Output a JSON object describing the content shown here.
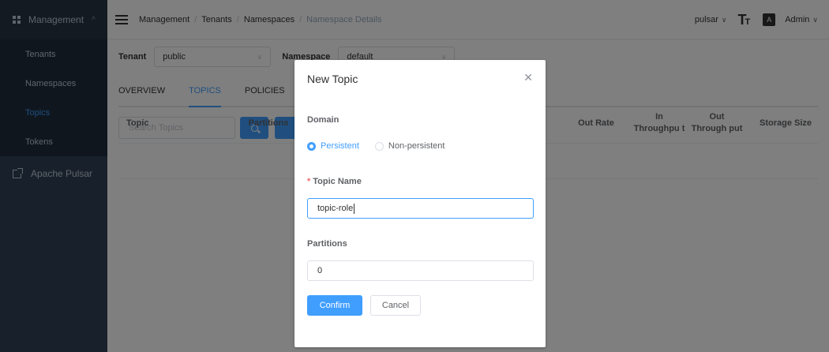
{
  "sidebar": {
    "header": "Management",
    "items": [
      {
        "label": "Tenants",
        "active": false
      },
      {
        "label": "Namespaces",
        "active": false
      },
      {
        "label": "Topics",
        "active": true
      },
      {
        "label": "Tokens",
        "active": false
      }
    ],
    "external": "Apache Pulsar"
  },
  "topbar": {
    "breadcrumb": [
      "Management",
      "Tenants",
      "Namespaces",
      "Namespace Details"
    ],
    "cluster": "pulsar",
    "user": "Admin"
  },
  "filters": {
    "tenant_label": "Tenant",
    "tenant_value": "public",
    "namespace_label": "Namespace",
    "namespace_value": "default"
  },
  "tabs": [
    "OVERVIEW",
    "TOPICS",
    "POLICIES"
  ],
  "active_tab": "TOPICS",
  "search": {
    "placeholder": "Search Topics"
  },
  "table": {
    "columns": [
      "Topic",
      "Partitions",
      "Out Rate",
      "In Throughpu t",
      "Out Through put",
      "Storage Size"
    ]
  },
  "dialog": {
    "title": "New Topic",
    "domain_label": "Domain",
    "domain_options": [
      "Persistent",
      "Non-persistent"
    ],
    "domain_selected": "Persistent",
    "topic_name_label": "Topic Name",
    "topic_name_value": "topic-role",
    "partitions_label": "Partitions",
    "partitions_value": "0",
    "confirm_label": "Confirm",
    "cancel_label": "Cancel"
  }
}
